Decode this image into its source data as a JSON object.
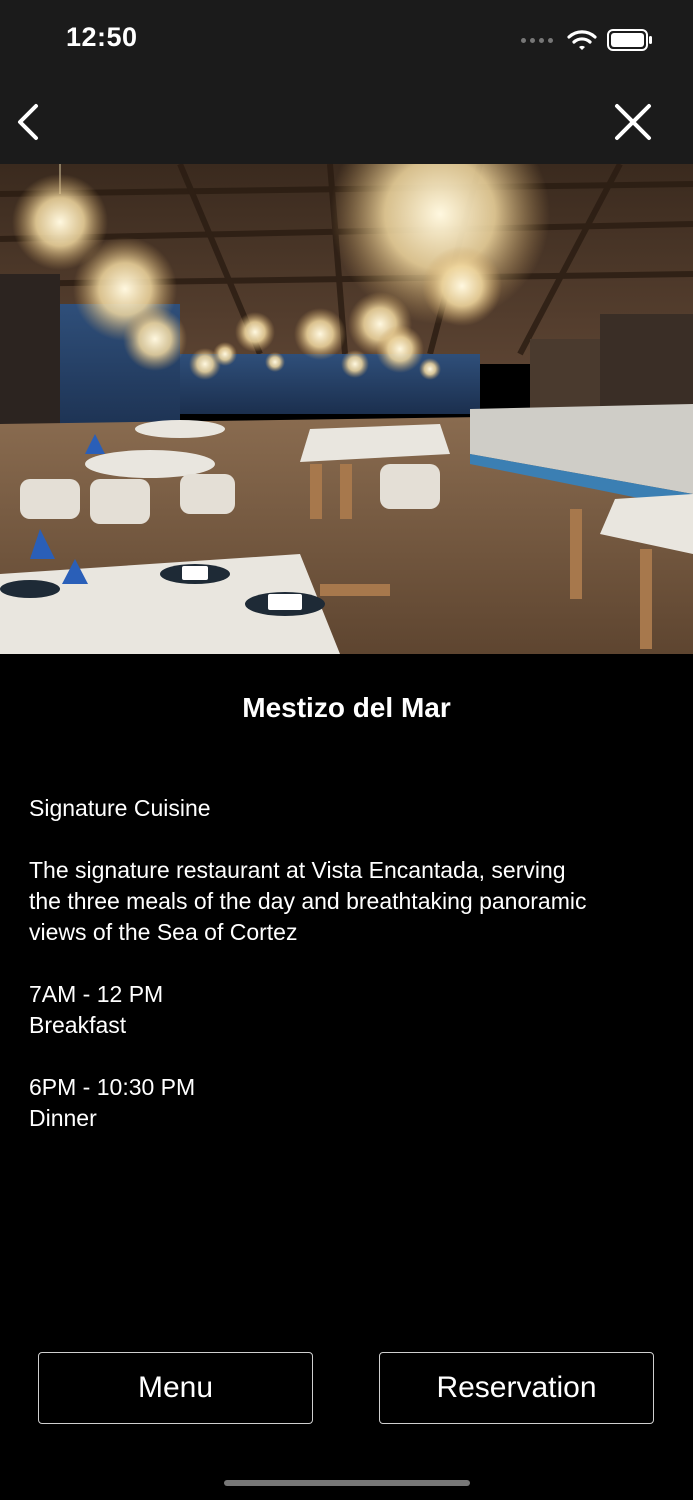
{
  "status_bar": {
    "time": "12:50"
  },
  "nav": {
    "back_icon": "chevron-left-icon",
    "close_icon": "close-icon"
  },
  "restaurant": {
    "name": "Mestizo del Mar",
    "cuisine": "Signature Cuisine",
    "description_lines": [
      "The signature restaurant at Vista Encantada, serving",
      "the three meals of the day and breathtaking panoramic",
      "views of the Sea of Cortez"
    ],
    "hours": [
      {
        "time": "7AM - 12 PM",
        "meal": "Breakfast"
      },
      {
        "time": "6PM - 10:30 PM",
        "meal": "Dinner"
      }
    ]
  },
  "buttons": {
    "menu": "Menu",
    "reservation": "Reservation"
  },
  "colors": {
    "background": "#000000",
    "bar": "#1b1b1b",
    "button_border": "#cfcfcf"
  }
}
